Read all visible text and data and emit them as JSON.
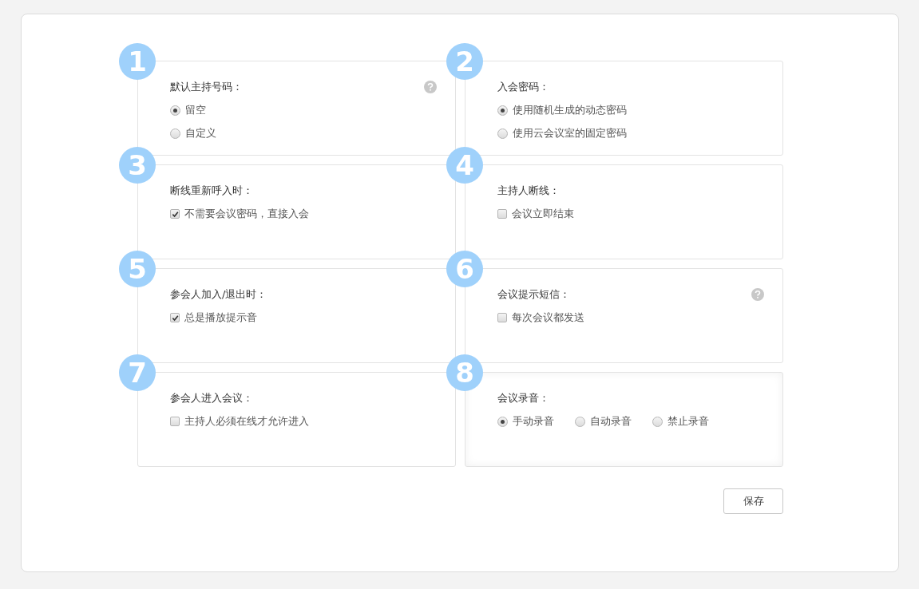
{
  "sections": [
    {
      "number": "1",
      "label": "默认主持号码：",
      "help": true,
      "kind": "stacked",
      "options": [
        {
          "kind": "radio",
          "text": "留空",
          "checked": true
        },
        {
          "kind": "radio",
          "text": "自定义",
          "checked": false
        }
      ]
    },
    {
      "number": "2",
      "label": "入会密码：",
      "help": false,
      "kind": "stacked",
      "options": [
        {
          "kind": "radio",
          "text": "使用随机生成的动态密码",
          "checked": true
        },
        {
          "kind": "radio",
          "text": "使用云会议室的固定密码",
          "checked": false
        }
      ]
    },
    {
      "number": "3",
      "label": "断线重新呼入时：",
      "help": false,
      "kind": "stacked",
      "options": [
        {
          "kind": "checkbox",
          "text": "不需要会议密码，直接入会",
          "checked": true
        }
      ]
    },
    {
      "number": "4",
      "label": "主持人断线：",
      "help": false,
      "kind": "stacked",
      "options": [
        {
          "kind": "checkbox",
          "text": "会议立即结束",
          "checked": false
        }
      ]
    },
    {
      "number": "5",
      "label": "参会人加入/退出时：",
      "help": false,
      "kind": "stacked",
      "options": [
        {
          "kind": "checkbox",
          "text": "总是播放提示音",
          "checked": true
        }
      ]
    },
    {
      "number": "6",
      "label": "会议提示短信：",
      "help": true,
      "kind": "stacked",
      "options": [
        {
          "kind": "checkbox",
          "text": "每次会议都发送",
          "checked": false
        }
      ]
    },
    {
      "number": "7",
      "label": "参会人进入会议：",
      "help": false,
      "kind": "stacked",
      "options": [
        {
          "kind": "checkbox",
          "text": "主持人必须在线才允许进入",
          "checked": false
        }
      ]
    },
    {
      "number": "8",
      "label": "会议录音：",
      "help": false,
      "kind": "inline",
      "options": [
        {
          "kind": "radio",
          "text": "手动录音",
          "checked": true
        },
        {
          "kind": "radio",
          "text": "自动录音",
          "checked": false
        },
        {
          "kind": "radio",
          "text": "禁止录音",
          "checked": false
        }
      ]
    }
  ],
  "save_button": "保存"
}
